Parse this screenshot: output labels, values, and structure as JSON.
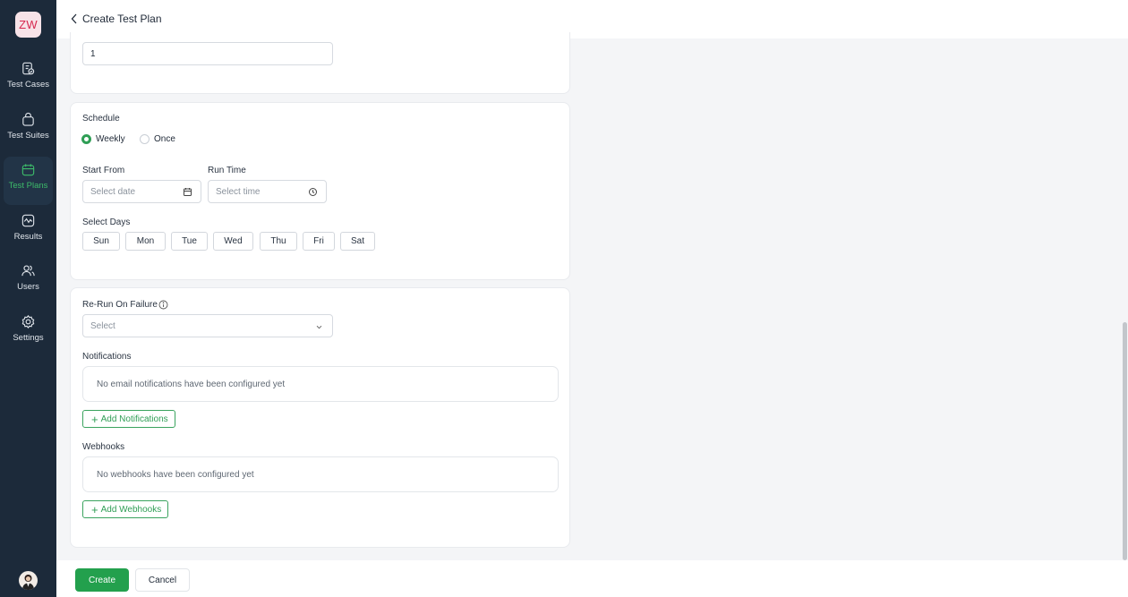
{
  "sidebar": {
    "logo": "ZW",
    "items": [
      {
        "label": "Test Cases",
        "icon": "test-cases-icon",
        "active": false
      },
      {
        "label": "Test Suites",
        "icon": "test-suites-icon",
        "active": false
      },
      {
        "label": "Test Plans",
        "icon": "test-plans-icon",
        "active": true
      },
      {
        "label": "Results",
        "icon": "results-icon",
        "active": false
      },
      {
        "label": "Users",
        "icon": "users-icon",
        "active": false
      },
      {
        "label": "Settings",
        "icon": "gear-icon",
        "active": false
      }
    ]
  },
  "header": {
    "title": "Create Test Plan"
  },
  "top_field": {
    "value": "1"
  },
  "schedule": {
    "label": "Schedule",
    "options": [
      {
        "label": "Weekly",
        "checked": true
      },
      {
        "label": "Once",
        "checked": false
      }
    ],
    "start_from_label": "Start From",
    "start_from_placeholder": "Select date",
    "run_time_label": "Run Time",
    "run_time_placeholder": "Select time",
    "select_days_label": "Select Days",
    "days": [
      "Sun",
      "Mon",
      "Tue",
      "Wed",
      "Thu",
      "Fri",
      "Sat"
    ]
  },
  "rerun": {
    "label": "Re-Run On Failure",
    "placeholder": "Select"
  },
  "notifications": {
    "label": "Notifications",
    "empty_text": "No email notifications have been configured yet",
    "add_label": "Add Notifications"
  },
  "webhooks": {
    "label": "Webhooks",
    "empty_text": "No webhooks have been configured yet",
    "add_label": "Add Webhooks"
  },
  "footer": {
    "create_label": "Create",
    "cancel_label": "Cancel"
  },
  "colors": {
    "sidebar_bg": "#1c2a3a",
    "accent": "#23a04d",
    "logo_text": "#d6284f"
  }
}
